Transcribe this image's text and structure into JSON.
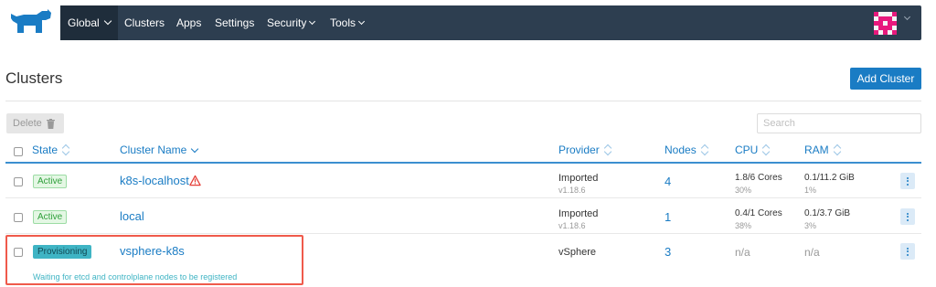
{
  "nav": {
    "global": "Global",
    "items": [
      "Clusters",
      "Apps",
      "Settings",
      "Security",
      "Tools"
    ]
  },
  "page": {
    "title": "Clusters",
    "add_button": "Add Cluster",
    "delete_button": "Delete",
    "search_placeholder": "Search"
  },
  "table": {
    "headers": {
      "state": "State",
      "name": "Cluster Name",
      "provider": "Provider",
      "nodes": "Nodes",
      "cpu": "CPU",
      "ram": "RAM"
    },
    "rows": [
      {
        "state": "Active",
        "name": "k8s-localhost",
        "provider": "Imported",
        "provider_version": "v1.18.6",
        "nodes": "4",
        "cpu": "1.8/6 Cores",
        "cpu_pct": "30%",
        "ram": "0.1/11.2 GiB",
        "ram_pct": "1%",
        "warning": true
      },
      {
        "state": "Active",
        "name": "local",
        "provider": "Imported",
        "provider_version": "v1.18.6",
        "nodes": "1",
        "cpu": "0.4/1 Cores",
        "cpu_pct": "38%",
        "ram": "0.1/3.7 GiB",
        "ram_pct": "3%"
      },
      {
        "state": "Provisioning",
        "name": "vsphere-k8s",
        "provider": "vSphere",
        "nodes": "3",
        "cpu": "n/a",
        "ram": "n/a",
        "message": "Waiting for etcd and controlplane nodes to be registered"
      }
    ]
  },
  "colors": {
    "navbar": "#2d3e50",
    "accent": "#1a7cc4",
    "active_green": "#2e9f3a",
    "provisioning_teal": "#3fb4c4",
    "highlight_red": "#ef5a4b"
  }
}
